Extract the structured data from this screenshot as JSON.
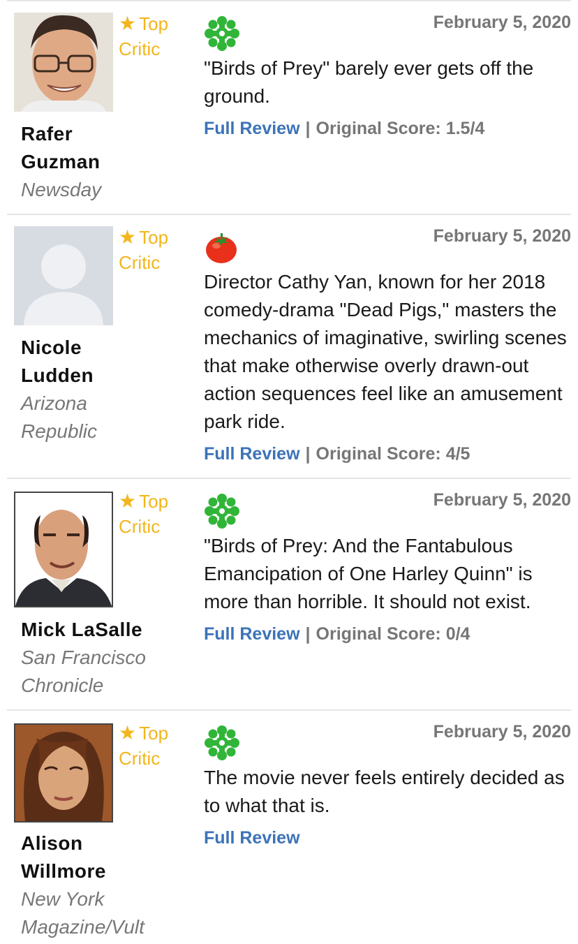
{
  "reviews": [
    {
      "top_critic_label_1": "Top",
      "top_critic_label_2": "Critic",
      "critic_first": "Rafer",
      "critic_last": "Guzman",
      "publication_1": "Newsday",
      "publication_2": "",
      "date": "February 5, 2020",
      "score_icon": "rotten-splat-icon",
      "quote": "\"Birds of Prey\" barely ever gets off the ground.",
      "full_review_label": "Full Review",
      "separator": "|",
      "original_score": "Original Score: 1.5/4"
    },
    {
      "top_critic_label_1": "Top",
      "top_critic_label_2": "Critic",
      "critic_first": "Nicole",
      "critic_last": "Ludden",
      "publication_1": "Arizona",
      "publication_2": "Republic",
      "date": "February 5, 2020",
      "score_icon": "fresh-tomato-icon",
      "quote": "Director Cathy Yan, known for her 2018 comedy-drama \"Dead Pigs,\" masters the mechanics of imaginative, swirling scenes that make otherwise overly drawn-out action sequences feel like an amusement park ride.",
      "full_review_label": "Full Review",
      "separator": "|",
      "original_score": "Original Score: 4/5"
    },
    {
      "top_critic_label_1": "Top",
      "top_critic_label_2": "Critic",
      "critic_first": "Mick LaSalle",
      "critic_last": "",
      "publication_1": "San Francisco",
      "publication_2": "Chronicle",
      "date": "February 5, 2020",
      "score_icon": "rotten-splat-icon",
      "quote": "\"Birds of Prey: And the Fantabulous Emancipation of One Harley Quinn\" is more than horrible. It should not exist.",
      "full_review_label": "Full Review",
      "separator": "|",
      "original_score": "Original Score: 0/4"
    },
    {
      "top_critic_label_1": "Top",
      "top_critic_label_2": "Critic",
      "critic_first": "Alison",
      "critic_last": "Willmore",
      "publication_1": "New York",
      "publication_2": "Magazine/Vult",
      "date": "February 5, 2020",
      "score_icon": "rotten-splat-icon",
      "quote": "The movie never feels entirely decided as to what that is.",
      "full_review_label": "Full Review"
    }
  ],
  "colors": {
    "top_critic": "#f2b61c",
    "link": "#3c73b8",
    "meta": "#767676",
    "splat": "#31b539",
    "tomato": "#e8301a"
  }
}
